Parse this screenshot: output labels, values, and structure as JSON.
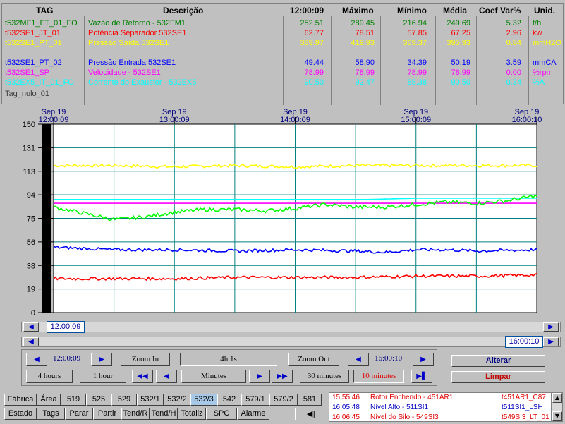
{
  "table": {
    "headers": {
      "tag": "TAG",
      "desc": "Descrição",
      "time": "12:00:09",
      "max": "Máximo",
      "min": "Mínimo",
      "avg": "Média",
      "cv": "Coef Var%",
      "unit": "Unid."
    },
    "rows": [
      {
        "tag": "t532MF1_FT_01_FO",
        "desc": "Vazão de Retorno - 532FM1",
        "cur": "252.51",
        "max": "289.45",
        "min": "216.94",
        "avg": "249.69",
        "cv": "5.32",
        "unit": "t/h",
        "color": "#008000"
      },
      {
        "tag": "t532SE1_JT_01",
        "desc": "Potência Separador 532SE1",
        "cur": "62.77",
        "max": "78.51",
        "min": "57.85",
        "avg": "67.25",
        "cv": "2.96",
        "unit": "kw",
        "color": "#ff0000"
      },
      {
        "tag": "t532SE1_PT_01",
        "desc": "Pressão Saída 532SE1",
        "cur": "389.97",
        "max": "419.93",
        "min": "369.37",
        "avg": "395.93",
        "cv": "0.84",
        "unit": "mmH2O",
        "color": "#ffff00"
      },
      {
        "tag": "t532SE1_PT_02",
        "desc": "Pressão Entrada 532SE1",
        "cur": "49.44",
        "max": "58.90",
        "min": "34.39",
        "avg": "50.19",
        "cv": "3.59",
        "unit": "mmCA",
        "color": "#0000ff"
      },
      {
        "tag": "t532SE1_SP",
        "desc": "Velocidade - 532SE1",
        "cur": "78.99",
        "max": "78.99",
        "min": "78.99",
        "avg": "78.99",
        "cv": "0.00",
        "unit": "%rpm",
        "color": "#ff00ff"
      },
      {
        "tag": "t532EX5_IT_01_FO",
        "desc": "Corrente do Exaustor - 532EX5",
        "cur": "90.50",
        "max": "92.47",
        "min": "88.38",
        "avg": "90.50",
        "cv": "0.34",
        "unit": "%A",
        "color": "#00ffff"
      },
      {
        "tag": "Tag_nulo_01",
        "desc": "",
        "cur": "",
        "max": "",
        "min": "",
        "avg": "",
        "cv": "",
        "unit": "",
        "color": "#404040"
      }
    ]
  },
  "chart_data": {
    "type": "line",
    "x_ticks": [
      {
        "date": "Sep 19",
        "time": "12:00:09"
      },
      {
        "date": "Sep 19",
        "time": "13:00:09"
      },
      {
        "date": "Sep 19",
        "time": "14:00:09"
      },
      {
        "date": "Sep 19",
        "time": "15:00:09"
      },
      {
        "date": "Sep 19",
        "time": "16:00:10"
      }
    ],
    "y_ticks": [
      "150",
      "131",
      "113",
      "94",
      "75",
      "56",
      "38",
      "19",
      "0"
    ],
    "ylim": [
      0,
      150
    ],
    "xlim_hours": [
      0,
      4
    ],
    "series": [
      {
        "color": "#ffff00",
        "points": [
          [
            0,
            117
          ],
          [
            0.5,
            117
          ],
          [
            1,
            116
          ],
          [
            1.5,
            117
          ],
          [
            2,
            116
          ],
          [
            2.5,
            117
          ],
          [
            3,
            117
          ],
          [
            3.5,
            117
          ],
          [
            4,
            117
          ]
        ]
      },
      {
        "color": "#ff00ff",
        "points": [
          [
            0,
            87
          ],
          [
            4,
            87
          ]
        ]
      },
      {
        "color": "#00ffff",
        "points": [
          [
            0,
            90
          ],
          [
            2.6,
            90
          ],
          [
            3,
            91
          ],
          [
            3.5,
            91
          ],
          [
            4,
            91
          ]
        ]
      },
      {
        "color": "#00ff00",
        "points": [
          [
            0,
            84
          ],
          [
            0.25,
            79
          ],
          [
            0.5,
            74
          ],
          [
            0.75,
            76
          ],
          [
            1,
            80
          ],
          [
            1.25,
            82
          ],
          [
            1.5,
            82
          ],
          [
            1.75,
            81
          ],
          [
            2,
            83
          ],
          [
            2.25,
            86
          ],
          [
            2.5,
            84
          ],
          [
            2.75,
            84
          ],
          [
            3,
            86
          ],
          [
            3.25,
            88
          ],
          [
            3.5,
            87
          ],
          [
            3.75,
            89
          ],
          [
            4,
            93
          ]
        ]
      },
      {
        "color": "#0000ff",
        "points": [
          [
            0,
            52
          ],
          [
            0.5,
            50
          ],
          [
            1,
            50
          ],
          [
            1.5,
            49
          ],
          [
            2,
            50
          ],
          [
            2.5,
            49
          ],
          [
            2.75,
            48
          ],
          [
            3,
            50
          ],
          [
            3.25,
            50
          ],
          [
            3.5,
            49
          ],
          [
            4,
            50
          ]
        ]
      },
      {
        "color": "#ff0000",
        "points": [
          [
            0,
            27
          ],
          [
            0.5,
            27
          ],
          [
            1,
            27
          ],
          [
            1.5,
            28
          ],
          [
            2,
            28
          ],
          [
            2.5,
            28
          ],
          [
            3,
            29
          ],
          [
            3.5,
            29
          ],
          [
            4,
            30
          ]
        ]
      }
    ]
  },
  "scroll": {
    "left_time": "12:00:09",
    "right_time": "16:00:10"
  },
  "controls": {
    "start_time": "12:00:09",
    "zoom_in": "Zoom In",
    "span": "4h 1s",
    "zoom_out": "Zoom Out",
    "end_time": "16:00:10",
    "alterar": "Alterar",
    "limpar": "Limpar",
    "btn_4h": "4 hours",
    "btn_1h": "1 hour",
    "btn_minutes": "Minutes",
    "btn_30m": "30 minutes",
    "btn_10m": "10 minutes"
  },
  "tabs_row1": [
    "Fábrica",
    "Área",
    "519",
    "525",
    "529",
    "532/1",
    "532/2",
    "532/3",
    "542",
    "579/1",
    "579/2",
    "581"
  ],
  "tabs_row2": [
    "Estado",
    "Tags",
    "Parar",
    "Partir",
    "Tend/R",
    "Tend/H",
    "Totaliz",
    "SPC",
    "Alarme"
  ],
  "alarms": [
    {
      "time": "15:55:46",
      "msg": "Rotor Enchendo - 451AR1",
      "tag": "t451AR1_C87"
    },
    {
      "time": "16:05:48",
      "msg": "Nível Alto - 511SI1",
      "tag": "t511SI1_LSH"
    },
    {
      "time": "16:06:45",
      "msg": "Nível do Silo - 549SI3",
      "tag": "t549SI3_LT_01"
    }
  ]
}
